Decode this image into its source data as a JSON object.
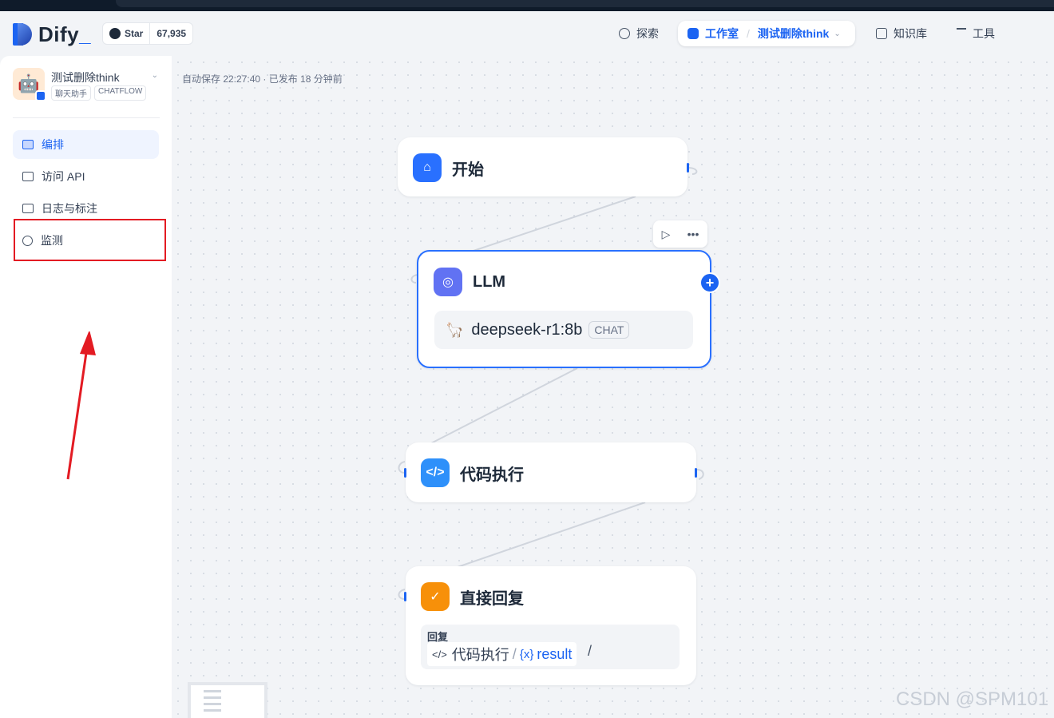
{
  "header": {
    "brand": "Dify",
    "github_star_label": "Star",
    "github_star_count": "67,935",
    "nav": {
      "explore": "探索",
      "studio": "工作室",
      "current_app": "测试删除think",
      "knowledge": "知识库",
      "tools": "工具"
    }
  },
  "sidebar": {
    "app_name": "测试删除think",
    "tags": [
      "聊天助手",
      "CHATFLOW"
    ],
    "items": [
      {
        "label": "编排",
        "active": true
      },
      {
        "label": "访问 API",
        "active": false
      },
      {
        "label": "日志与标注",
        "active": false
      },
      {
        "label": "监测",
        "active": false
      }
    ]
  },
  "canvas": {
    "save_status": "自动保存 22:27:40 · 已发布 18 分钟前",
    "nodes": {
      "start": {
        "title": "开始"
      },
      "llm": {
        "title": "LLM",
        "model": "deepseek-r1:8b",
        "model_tag": "CHAT"
      },
      "code": {
        "title": "代码执行"
      },
      "answer": {
        "title": "直接回复",
        "reply_label": "回复",
        "var_node": "代码执行",
        "var_name": "result"
      }
    }
  },
  "watermark": "CSDN @SPM101",
  "colors": {
    "accent": "#1c64f2",
    "highlight": "#e31b23",
    "answer_icon": "#f79009",
    "llm_icon": "#6172f3"
  }
}
